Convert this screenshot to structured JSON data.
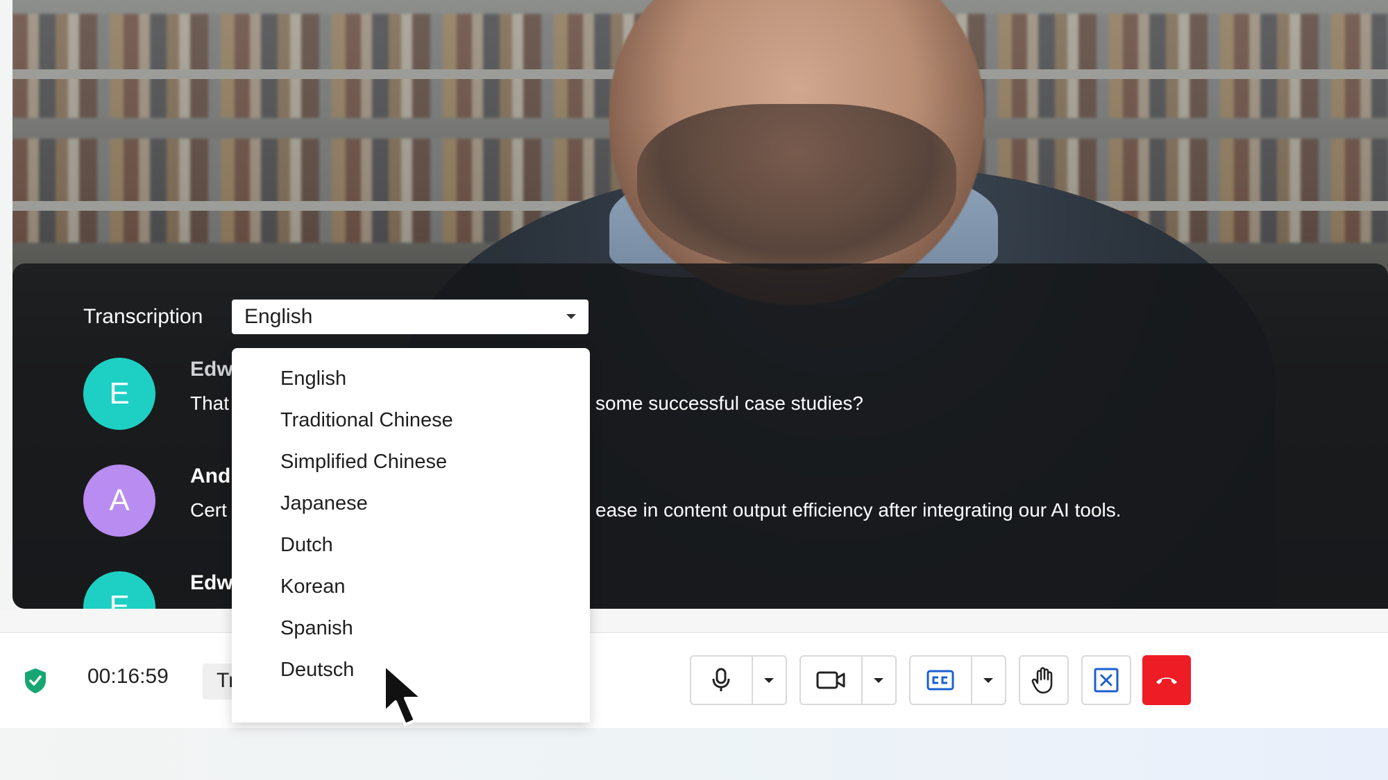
{
  "transcription": {
    "label": "Transcription",
    "selected_language": "English",
    "languages": [
      "English",
      "Traditional Chinese",
      "Simplified Chinese",
      "Japanese",
      "Dutch",
      "Korean",
      "Spanish",
      "Deutsch"
    ]
  },
  "messages": [
    {
      "initial": "E",
      "speaker": "Edw",
      "text_prefix": "That",
      "text_suffix": "some successful case studies?",
      "avatar_color": "#1ed0c3"
    },
    {
      "initial": "A",
      "speaker": "And",
      "text_prefix": "Cert",
      "text_suffix": "ease in content output efficiency after integrating our AI tools.",
      "avatar_color": "#b88cf0"
    },
    {
      "initial": "E",
      "speaker": "Edw",
      "avatar_color": "#1ed0c3"
    }
  ],
  "toolbar": {
    "timer": "00:16:59",
    "pill_text": "Tr",
    "end_call_color": "#ee1c25",
    "icons": [
      "shield-check-icon",
      "microphone-icon",
      "video-camera-icon",
      "closed-caption-icon",
      "raise-hand-icon",
      "close-box-icon",
      "phone-hangup-icon"
    ]
  }
}
